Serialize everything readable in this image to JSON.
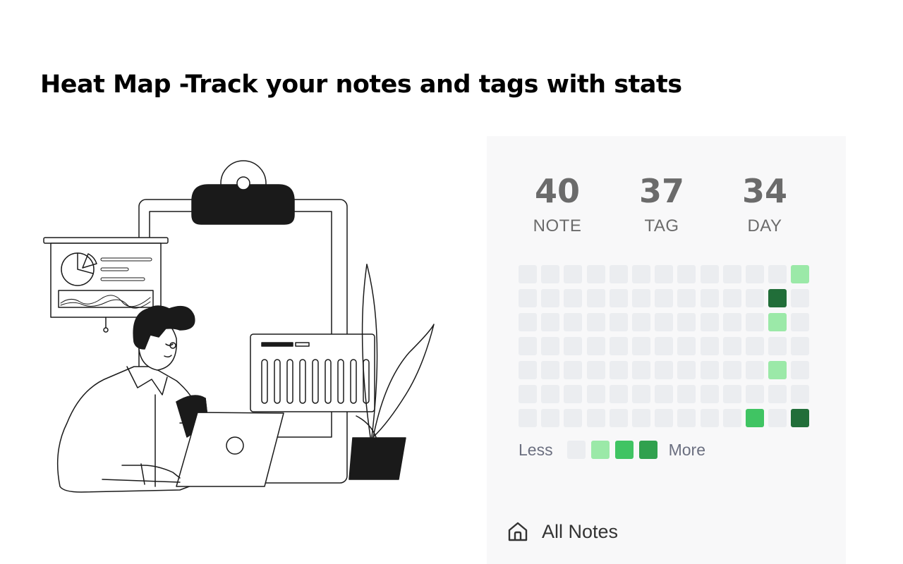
{
  "header": {
    "title": "Heat Map -Track your notes and tags with stats"
  },
  "stats": [
    {
      "value": "40",
      "label": "NOTE"
    },
    {
      "value": "37",
      "label": "TAG"
    },
    {
      "value": "34",
      "label": "DAY"
    }
  ],
  "heatmap": {
    "columns": 13,
    "rows": 7,
    "levels": [
      [
        0,
        0,
        0,
        0,
        0,
        0,
        0,
        0,
        0,
        0,
        0,
        0,
        1
      ],
      [
        0,
        0,
        0,
        0,
        0,
        0,
        0,
        0,
        0,
        0,
        0,
        4,
        0
      ],
      [
        0,
        0,
        0,
        0,
        0,
        0,
        0,
        0,
        0,
        0,
        0,
        1,
        0
      ],
      [
        0,
        0,
        0,
        0,
        0,
        0,
        0,
        0,
        0,
        0,
        0,
        0,
        0
      ],
      [
        0,
        0,
        0,
        0,
        0,
        0,
        0,
        0,
        0,
        0,
        0,
        1,
        0
      ],
      [
        0,
        0,
        0,
        0,
        0,
        0,
        0,
        0,
        0,
        0,
        0,
        0,
        0
      ],
      [
        0,
        0,
        0,
        0,
        0,
        0,
        0,
        0,
        0,
        0,
        2,
        0,
        4
      ]
    ],
    "level_colors": [
      "#ebedf0",
      "#9be9a8",
      "#40c463",
      "#30a14e",
      "#216e39"
    ]
  },
  "legend": {
    "less_label": "Less",
    "more_label": "More",
    "colors": [
      "#ebedf0",
      "#9be9a8",
      "#40c463",
      "#30a14e"
    ]
  },
  "nav": {
    "all_notes_label": "All Notes",
    "icon": "home-icon"
  }
}
